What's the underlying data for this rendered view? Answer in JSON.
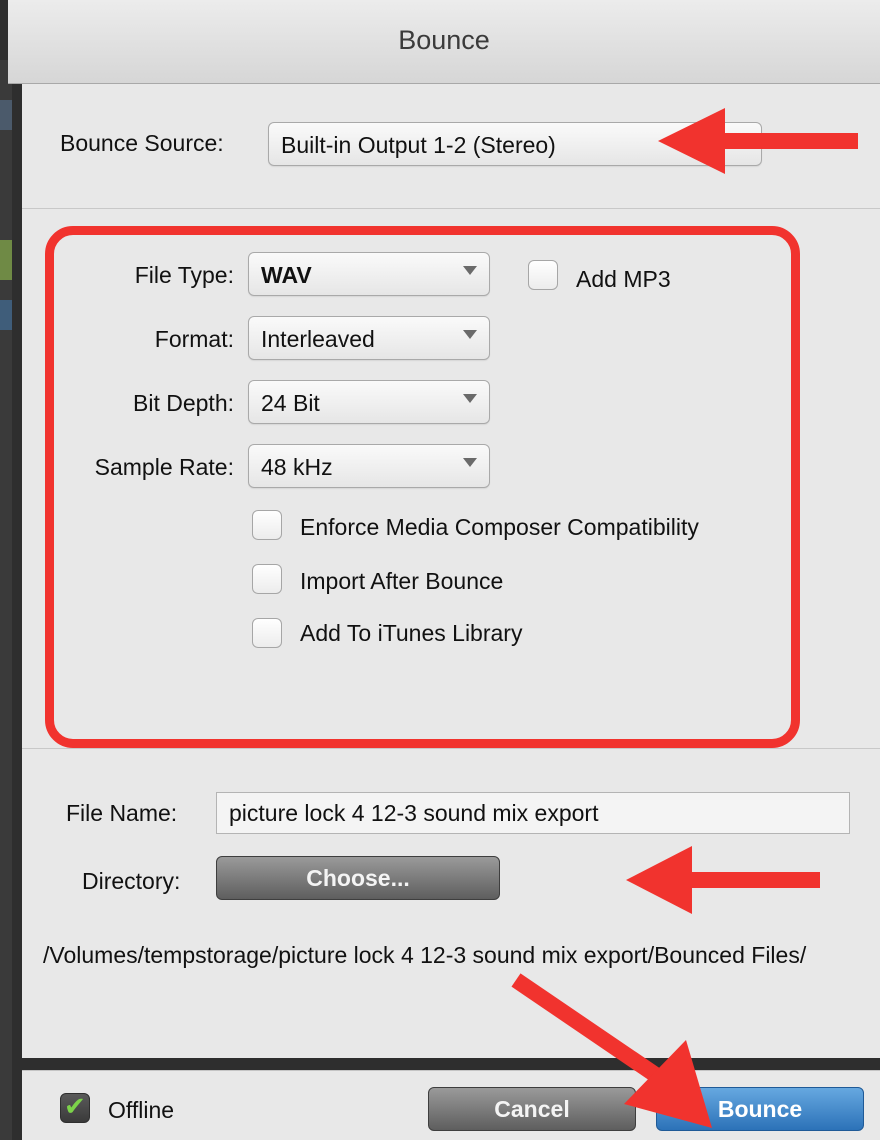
{
  "window": {
    "title": "Bounce"
  },
  "bounce_source": {
    "label": "Bounce Source:",
    "value": "Built-in Output 1-2 (Stereo)"
  },
  "file_type": {
    "label": "File Type:",
    "value": "WAV"
  },
  "format": {
    "label": "Format:",
    "value": "Interleaved"
  },
  "bit_depth": {
    "label": "Bit Depth:",
    "value": "24 Bit"
  },
  "sample_rate": {
    "label": "Sample Rate:",
    "value": "48 kHz"
  },
  "checkboxes": {
    "add_mp3": {
      "label": "Add MP3",
      "checked": false
    },
    "enforce_media_composer": {
      "label": "Enforce Media Composer Compatibility",
      "checked": false
    },
    "import_after_bounce": {
      "label": "Import After Bounce",
      "checked": false
    },
    "add_to_itunes": {
      "label": "Add To iTunes Library",
      "checked": false
    },
    "offline": {
      "label": "Offline",
      "checked": true
    }
  },
  "file_name": {
    "label": "File Name:",
    "value": "picture lock 4 12-3 sound mix export"
  },
  "directory": {
    "label": "Directory:",
    "button_label": "Choose...",
    "path": "/Volumes/tempstorage/picture lock 4 12-3 sound mix export/Bounced Files/"
  },
  "footer": {
    "cancel_label": "Cancel",
    "bounce_label": "Bounce"
  },
  "annotations": {
    "color": "#f1332e",
    "arrow_icons": [
      "red-arrow-icon",
      "red-arrow-icon",
      "red-arrow-icon"
    ]
  },
  "icons": {
    "offline_check": "checkmark-icon",
    "dropdown": "chevron-down-icon"
  }
}
